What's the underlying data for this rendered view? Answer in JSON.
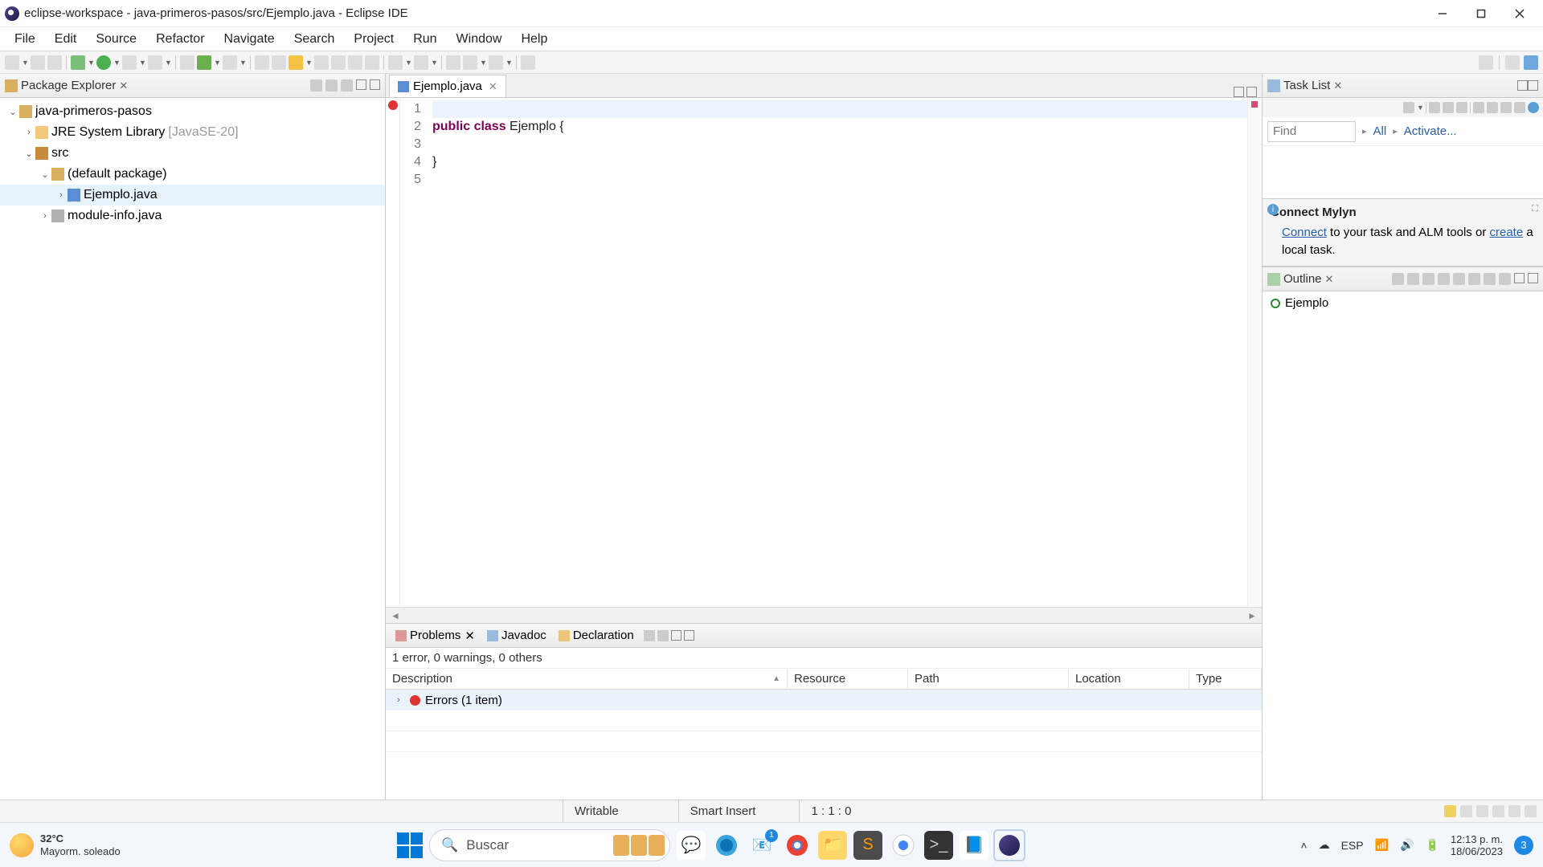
{
  "window": {
    "title": "eclipse-workspace - java-primeros-pasos/src/Ejemplo.java - Eclipse IDE"
  },
  "menu": [
    "File",
    "Edit",
    "Source",
    "Refactor",
    "Navigate",
    "Search",
    "Project",
    "Run",
    "Window",
    "Help"
  ],
  "package_explorer": {
    "title": "Package Explorer",
    "project": "java-primeros-pasos",
    "jre": "JRE System Library",
    "jre_ver": "[JavaSE-20]",
    "src": "src",
    "pkg": "(default package)",
    "file1": "Ejemplo.java",
    "file2": "module-info.java"
  },
  "editor": {
    "tab": "Ejemplo.java",
    "lines": [
      "1",
      "2",
      "3",
      "4",
      "5"
    ],
    "code_l2_kw1": "public",
    "code_l2_kw2": "class",
    "code_l2_rest": " Ejemplo {",
    "code_l4": "}"
  },
  "problems": {
    "tabs": {
      "problems": "Problems",
      "javadoc": "Javadoc",
      "declaration": "Declaration"
    },
    "summary": "1 error, 0 warnings, 0 others",
    "cols": {
      "desc": "Description",
      "res": "Resource",
      "path": "Path",
      "loc": "Location",
      "type": "Type"
    },
    "row1": "Errors (1 item)"
  },
  "tasklist": {
    "title": "Task List",
    "find_ph": "Find",
    "all": "All",
    "activate": "Activate..."
  },
  "mylyn": {
    "title": "Connect Mylyn",
    "connect": "Connect",
    "text1": " to your task and ALM tools or ",
    "create": "create",
    "text2": " a local task."
  },
  "outline": {
    "title": "Outline",
    "item": "Ejemplo"
  },
  "status": {
    "writable": "Writable",
    "insert": "Smart Insert",
    "pos": "1 : 1 : 0"
  },
  "taskbar": {
    "temp": "32°C",
    "weather": "Mayorm. soleado",
    "search_ph": "Buscar",
    "lang": "ESP",
    "time": "12:13 p. m.",
    "date": "18/06/2023",
    "notif": "3"
  }
}
